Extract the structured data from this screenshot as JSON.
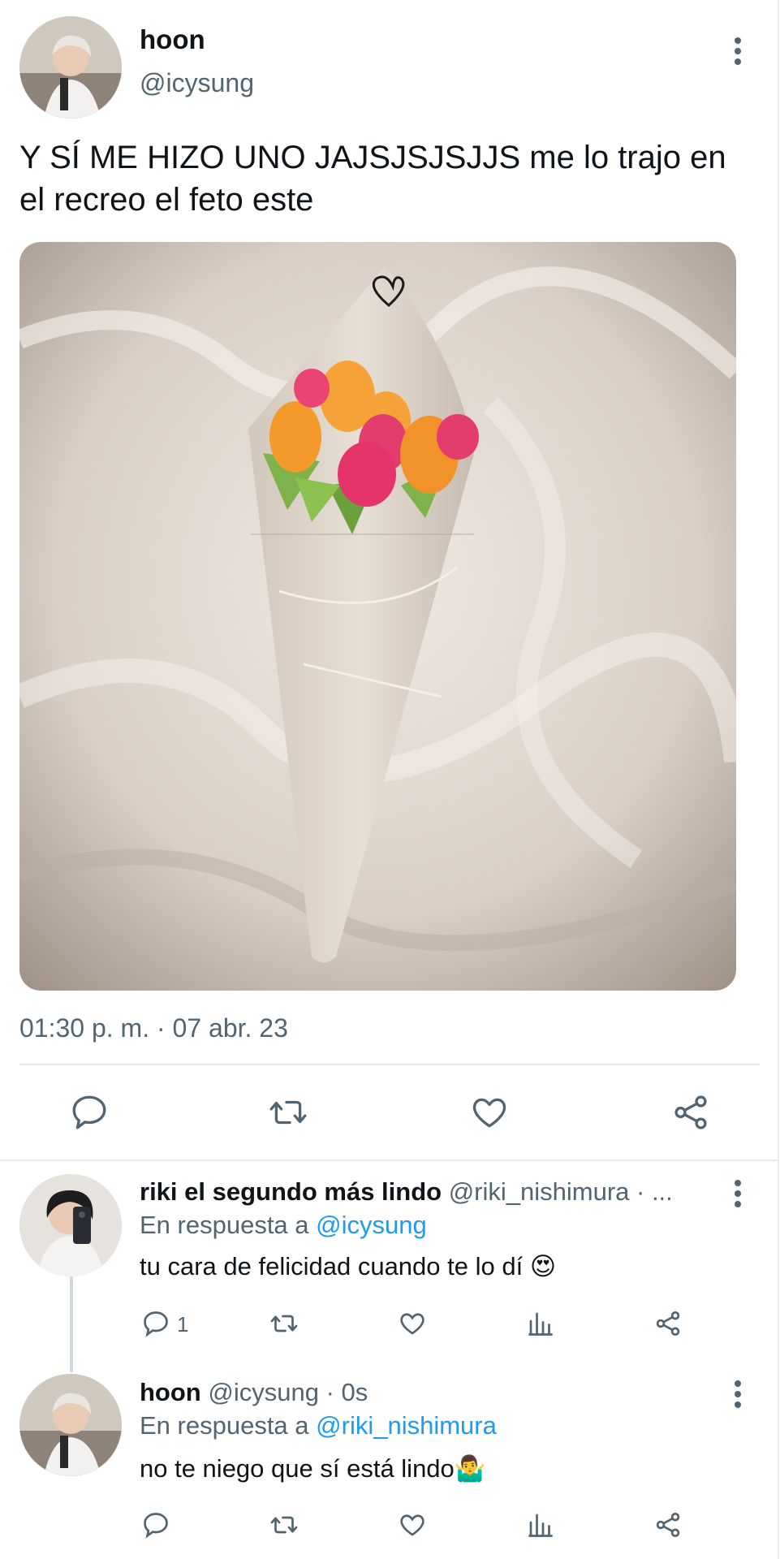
{
  "main_tweet": {
    "display_name": "hoon",
    "handle": "@icysung",
    "text": "Y SÍ ME HIZO UNO JAJSJSJSJJS me lo trajo en el recreo el feto este",
    "timestamp": "01:30 p. m. · 07 abr. 23",
    "actions": [
      "reply-icon",
      "retweet-icon",
      "like-icon",
      "share-icon"
    ]
  },
  "replies": [
    {
      "display_name": "riki el segundo más lindo",
      "handle": "@riki_nishimura · ...",
      "reply_prefix": "En respuesta a",
      "reply_to": "@icysung",
      "text": "tu cara de felicidad cuando te lo dí 😍",
      "reply_count": "1"
    },
    {
      "display_name": "hoon",
      "handle": "@icysung · 0s",
      "reply_prefix": "En respuesta a",
      "reply_to": "@riki_nishimura",
      "text": "no te niego que sí está lindo🤷‍♂️"
    }
  ],
  "colors": {
    "link": "#1d9bf0",
    "muted": "#536471",
    "divider": "#e6e9ec"
  }
}
